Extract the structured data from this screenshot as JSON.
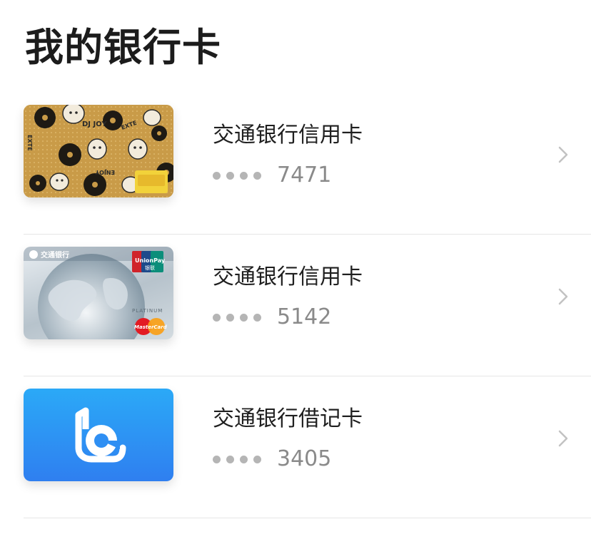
{
  "page": {
    "title": "我的银行卡"
  },
  "colors": {
    "title": "#1c1c1c",
    "card_name": "#1f1f1f",
    "last_digits": "#8a8a8a",
    "masked_dots": "#b5b5b5",
    "divider": "#e6e6e6",
    "debit_card_blue": "#2f8ff3",
    "credit_card_gold": "#c79a46"
  },
  "cards": [
    {
      "name": "交通银行信用卡",
      "mask_icon": "four-dots",
      "last_digits": "7471",
      "card_art": "gold-vinyl-record-pattern",
      "card_text": "DJ JOY"
    },
    {
      "name": "交通银行信用卡",
      "mask_icon": "four-dots",
      "last_digits": "5142",
      "card_art": "silver-globe",
      "card_text": "交通银行",
      "brand_text": "PLATINUM"
    },
    {
      "name": "交通银行借记卡",
      "mask_icon": "four-dots",
      "last_digits": "3405",
      "card_art": "blue-bocom-logo"
    }
  ]
}
